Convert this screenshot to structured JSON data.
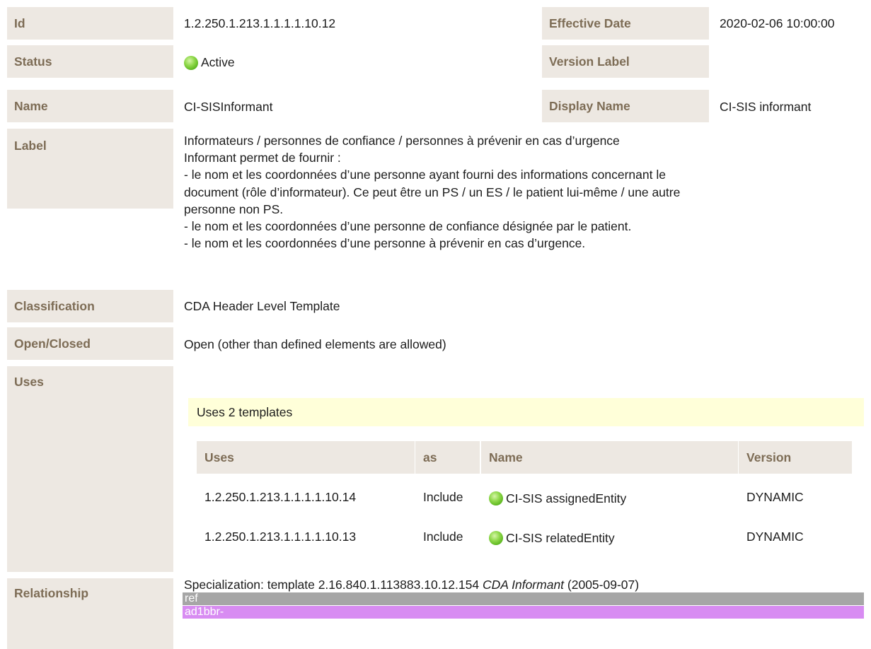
{
  "rows": {
    "id": {
      "label": "Id",
      "value": "1.2.250.1.213.1.1.1.1.10.12"
    },
    "effective_date": {
      "label": "Effective Date",
      "value": "2020-02-06 10:00:00"
    },
    "status": {
      "label": "Status",
      "value": "Active"
    },
    "version_label": {
      "label": "Version Label",
      "value": ""
    },
    "name": {
      "label": "Name",
      "value": "CI-SISInformant"
    },
    "display_name": {
      "label": "Display Name",
      "value": "CI-SIS informant"
    },
    "label": {
      "label": "Label",
      "lines": [
        "Informateurs / personnes de confiance / personnes à prévenir en cas d’urgence",
        "Informant permet de fournir :",
        "- le nom et les coordonnées d’une personne ayant fourni des informations concernant le",
        "document (rôle d’informateur). Ce peut être un PS / un ES / le patient lui-même / une autre",
        "personne non PS.",
        "- le nom et les coordonnées d’une personne de confiance désignée par le patient.",
        "- le nom et les coordonnées d’une personne à prévenir en cas d’urgence."
      ]
    },
    "classification": {
      "label": "Classification",
      "value": "CDA Header Level Template"
    },
    "open_closed": {
      "label": "Open/Closed",
      "value": "Open (other than defined elements are allowed)"
    },
    "uses": {
      "label": "Uses",
      "summary": "Uses 2 templates",
      "headers": [
        "Uses",
        "as",
        "Name",
        "Version"
      ],
      "items": [
        {
          "id": "1.2.250.1.213.1.1.1.1.10.14",
          "as": "Include",
          "name": "CI-SIS assignedEntity",
          "version": "DYNAMIC"
        },
        {
          "id": "1.2.250.1.213.1.1.1.1.10.13",
          "as": "Include",
          "name": "CI-SIS relatedEntity",
          "version": "DYNAMIC"
        }
      ]
    },
    "relationship": {
      "label": "Relationship",
      "prefix": "Specialization: template 2.16.840.1.113883.10.12.154 ",
      "template_name": "CDA Informant",
      "suffix": " (2005-09-07)",
      "ref_tag": "ref",
      "prefix_tag": "ad1bbr-"
    }
  },
  "colors": {
    "label_bg": "#ede8e2",
    "label_text": "#7d6c55",
    "uses_box_bg": "#ffffd9",
    "ref_bar": "#a6a6a6",
    "prefix_bar": "#d88cf2",
    "status_active": "#7ac943"
  }
}
